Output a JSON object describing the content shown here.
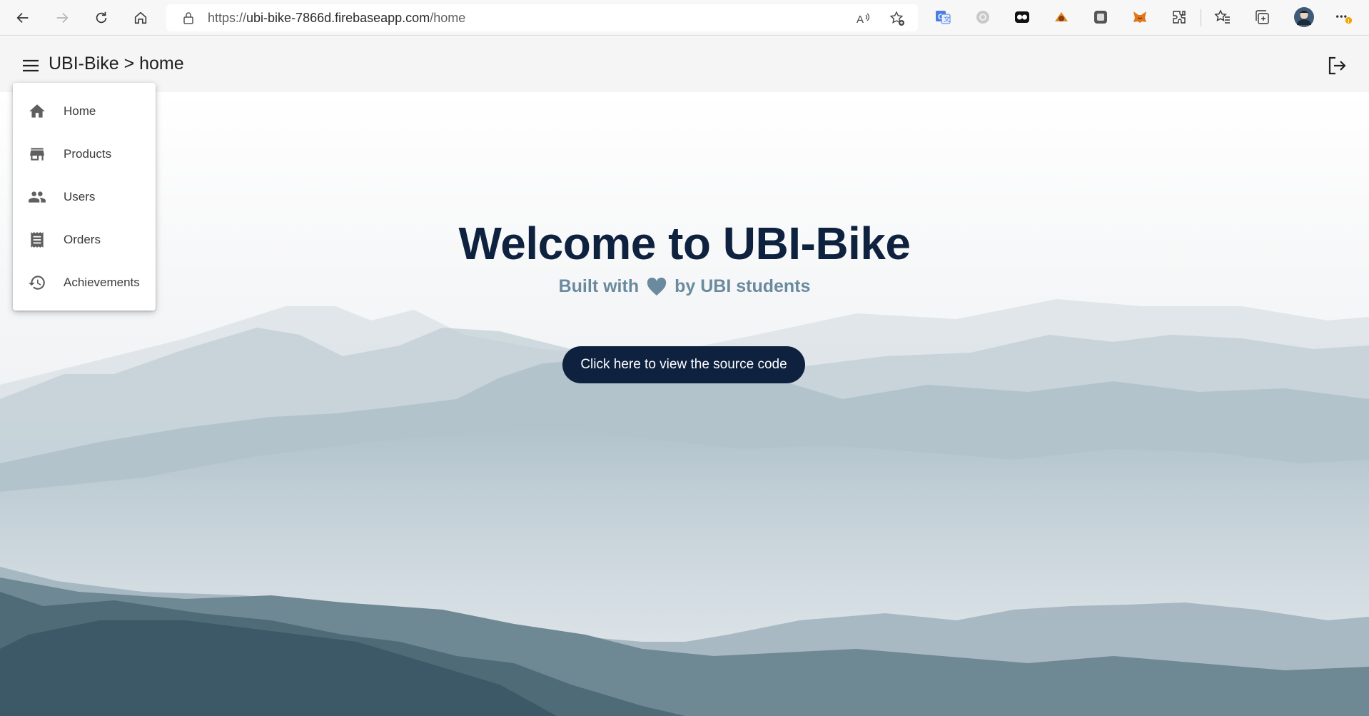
{
  "browser": {
    "url_prefix": "https://",
    "url_host": "ubi-bike-7866d.firebaseapp.com",
    "url_path": "/home",
    "icons": [
      "back-icon",
      "forward-icon",
      "refresh-icon",
      "home-icon",
      "lock-icon",
      "read-aloud-icon",
      "add-favorite-icon",
      "translate-extension-icon",
      "extension-icon",
      "extension-icon",
      "extension-icon",
      "extension-icon",
      "metamask-icon",
      "extensions-icon",
      "favorites-icon",
      "collections-icon",
      "profile-avatar",
      "more-icon"
    ]
  },
  "header": {
    "title": "UBI-Bike > home"
  },
  "menu": {
    "items": [
      {
        "label": "Home",
        "icon": "home-icon"
      },
      {
        "label": "Products",
        "icon": "store-icon"
      },
      {
        "label": "Users",
        "icon": "people-icon"
      },
      {
        "label": "Orders",
        "icon": "receipt-icon"
      },
      {
        "label": "Achievements",
        "icon": "history-icon"
      }
    ]
  },
  "hero": {
    "title": "Welcome to UBI-Bike",
    "subtitle_before": "Built with",
    "subtitle_after": "by UBI students",
    "cta_label": "Click here to view the source code"
  },
  "colors": {
    "primary": "#0e2240",
    "subtitle": "#6a8a9e",
    "header_bg": "#f5f5f5"
  }
}
